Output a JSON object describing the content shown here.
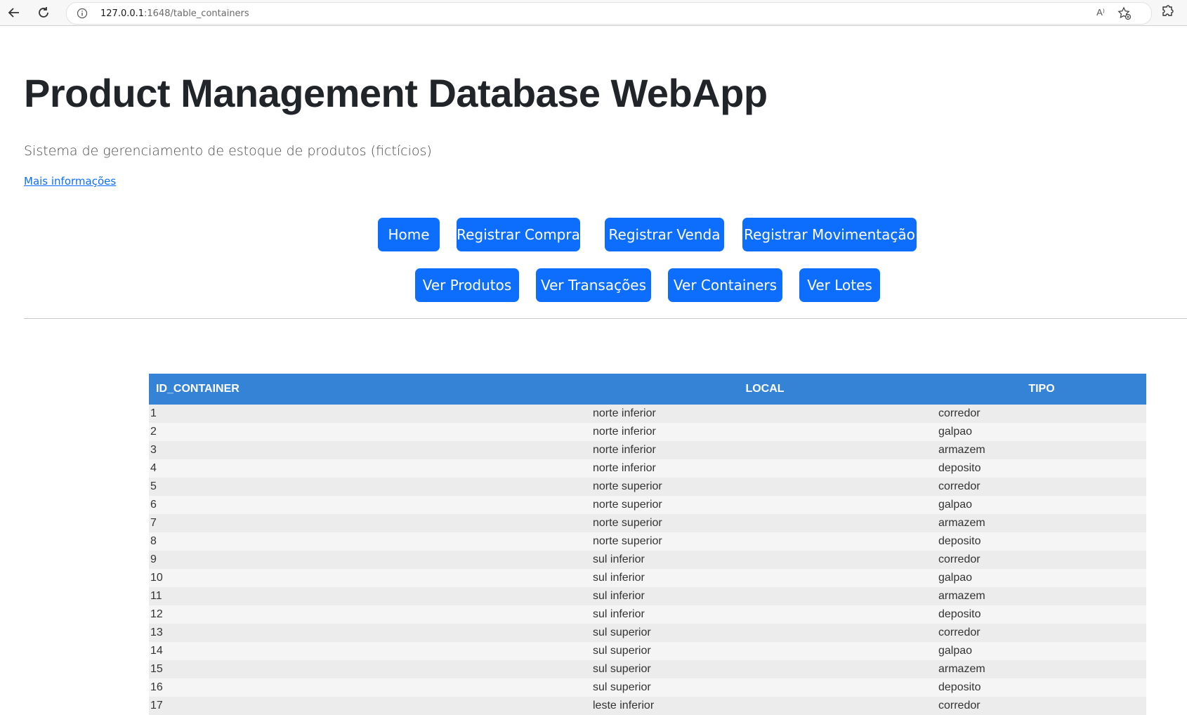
{
  "browser": {
    "url_host": "127.0.0.1",
    "url_path": ":1648/table_containers",
    "read_aloud": "A⁾"
  },
  "header": {
    "title": "Product Management Database WebApp",
    "subtitle": "Sistema de gerenciamento de estoque de produtos (fictícios)",
    "more_link": "Mais informações"
  },
  "nav": {
    "row1": [
      "Home",
      "Registrar Compra",
      "Registrar Venda",
      "Registrar Movimentação"
    ],
    "row2": [
      "Ver Produtos",
      "Ver Transações",
      "Ver Containers",
      "Ver Lotes"
    ]
  },
  "table": {
    "headers": [
      "ID_CONTAINER",
      "LOCAL",
      "TIPO"
    ],
    "rows": [
      [
        "1",
        "norte inferior",
        "corredor"
      ],
      [
        "2",
        "norte inferior",
        "galpao"
      ],
      [
        "3",
        "norte inferior",
        "armazem"
      ],
      [
        "4",
        "norte inferior",
        "deposito"
      ],
      [
        "5",
        "norte superior",
        "corredor"
      ],
      [
        "6",
        "norte superior",
        "galpao"
      ],
      [
        "7",
        "norte superior",
        "armazem"
      ],
      [
        "8",
        "norte superior",
        "deposito"
      ],
      [
        "9",
        "sul inferior",
        "corredor"
      ],
      [
        "10",
        "sul inferior",
        "galpao"
      ],
      [
        "11",
        "sul inferior",
        "armazem"
      ],
      [
        "12",
        "sul inferior",
        "deposito"
      ],
      [
        "13",
        "sul superior",
        "corredor"
      ],
      [
        "14",
        "sul superior",
        "galpao"
      ],
      [
        "15",
        "sul superior",
        "armazem"
      ],
      [
        "16",
        "sul superior",
        "deposito"
      ],
      [
        "17",
        "leste inferior",
        "corredor"
      ]
    ]
  },
  "colors": {
    "primary": "#0d6efd",
    "table_header": "#3583d6"
  }
}
